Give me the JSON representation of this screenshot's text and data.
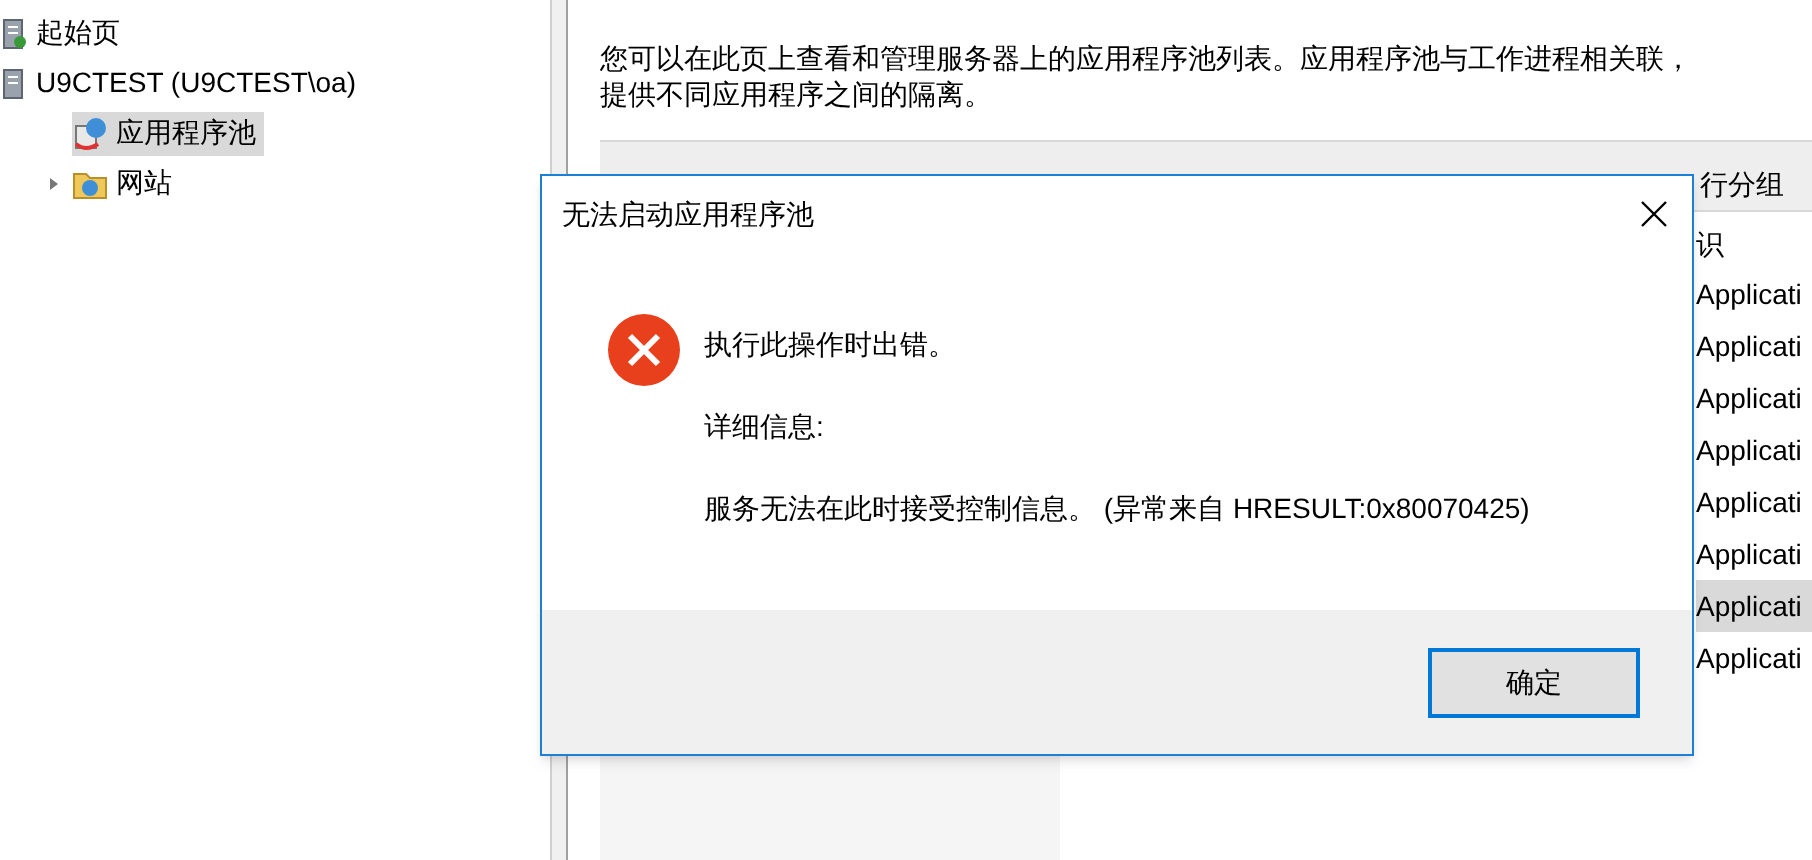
{
  "tree": [
    {
      "label": "起始页",
      "selected": false
    },
    {
      "label": "U9CTEST (U9CTEST\\oa)",
      "selected": false,
      "children": [
        {
          "label": "应用程序池",
          "selected": true
        },
        {
          "label": "网站",
          "selected": false,
          "expanded": false
        }
      ]
    }
  ],
  "description": [
    "您可以在此页上查看和管理服务器上的应用程序池列表。应用程序池与工作进程相关联，",
    "提供不同应用程序之间的隔离。"
  ],
  "toolbar": {
    "group_value": "行分组"
  },
  "table": {
    "column_header": "识",
    "rows": [
      {
        "cell": "Applicati",
        "selected": false
      },
      {
        "cell": "Applicati",
        "selected": false
      },
      {
        "cell": "Applicati",
        "selected": false
      },
      {
        "cell": "Applicati",
        "selected": false
      },
      {
        "cell": "Applicati",
        "selected": false
      },
      {
        "cell": "Applicati",
        "selected": false
      },
      {
        "cell": "Applicati",
        "selected": true
      },
      {
        "cell": "Applicati",
        "selected": false
      }
    ]
  },
  "dialog": {
    "title": "无法启动应用程序池",
    "message": "执行此操作时出错。",
    "details_label": "详细信息:",
    "details": "服务无法在此时接受控制信息。 (异常来自 HRESULT:0x80070425)",
    "button": "确定"
  }
}
